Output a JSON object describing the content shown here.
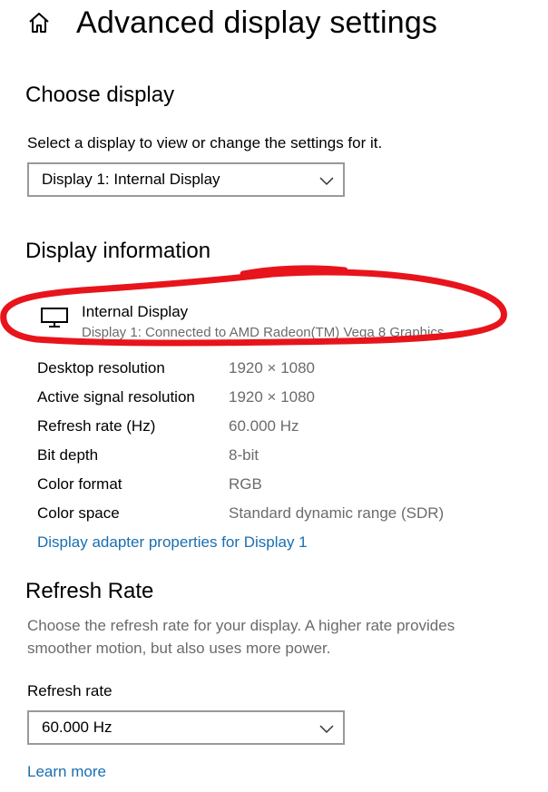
{
  "header": {
    "title": "Advanced display settings",
    "home_icon": "home-icon"
  },
  "choose_display": {
    "heading": "Choose display",
    "instruction": "Select a display to view or change the settings for it.",
    "selected_display": "Display 1: Internal Display"
  },
  "display_info": {
    "heading": "Display information",
    "monitor_icon": "monitor-icon",
    "display_name": "Internal Display",
    "display_connection": "Display 1: Connected to AMD Radeon(TM) Vega 8 Graphics",
    "rows": [
      {
        "label": "Desktop resolution",
        "value": "1920 × 1080"
      },
      {
        "label": "Active signal resolution",
        "value": "1920 × 1080"
      },
      {
        "label": "Refresh rate (Hz)",
        "value": "60.000 Hz"
      },
      {
        "label": "Bit depth",
        "value": "8-bit"
      },
      {
        "label": "Color format",
        "value": "RGB"
      },
      {
        "label": "Color space",
        "value": "Standard dynamic range (SDR)"
      }
    ],
    "adapter_link": "Display adapter properties for Display 1"
  },
  "refresh_rate": {
    "heading": "Refresh Rate",
    "description": "Choose the refresh rate for your display. A higher rate provides smoother motion, but also uses more power.",
    "field_label": "Refresh rate",
    "selected_rate": "60.000 Hz",
    "learn_more": "Learn more"
  },
  "colors": {
    "annotation_red": "#e8141c",
    "link_blue": "#1a6eb0",
    "secondary_text": "#6b6b6b",
    "dropdown_border": "#999999"
  }
}
